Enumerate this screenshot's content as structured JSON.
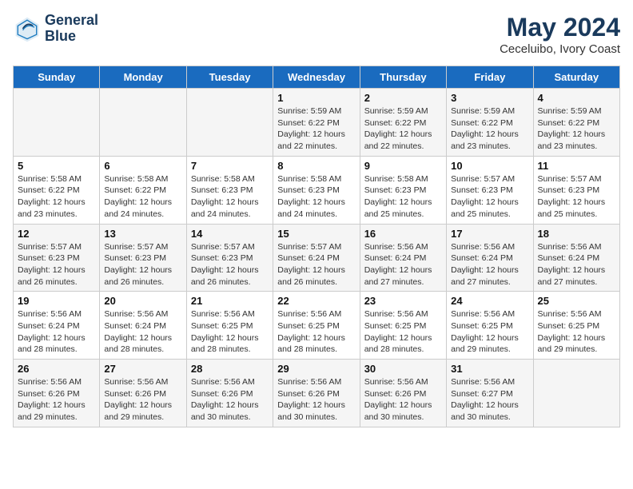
{
  "header": {
    "logo_line1": "General",
    "logo_line2": "Blue",
    "month_year": "May 2024",
    "location": "Ceceluibo, Ivory Coast"
  },
  "weekdays": [
    "Sunday",
    "Monday",
    "Tuesday",
    "Wednesday",
    "Thursday",
    "Friday",
    "Saturday"
  ],
  "weeks": [
    [
      {
        "day": "",
        "info": ""
      },
      {
        "day": "",
        "info": ""
      },
      {
        "day": "",
        "info": ""
      },
      {
        "day": "1",
        "info": "Sunrise: 5:59 AM\nSunset: 6:22 PM\nDaylight: 12 hours\nand 22 minutes."
      },
      {
        "day": "2",
        "info": "Sunrise: 5:59 AM\nSunset: 6:22 PM\nDaylight: 12 hours\nand 22 minutes."
      },
      {
        "day": "3",
        "info": "Sunrise: 5:59 AM\nSunset: 6:22 PM\nDaylight: 12 hours\nand 23 minutes."
      },
      {
        "day": "4",
        "info": "Sunrise: 5:59 AM\nSunset: 6:22 PM\nDaylight: 12 hours\nand 23 minutes."
      }
    ],
    [
      {
        "day": "5",
        "info": "Sunrise: 5:58 AM\nSunset: 6:22 PM\nDaylight: 12 hours\nand 23 minutes."
      },
      {
        "day": "6",
        "info": "Sunrise: 5:58 AM\nSunset: 6:22 PM\nDaylight: 12 hours\nand 24 minutes."
      },
      {
        "day": "7",
        "info": "Sunrise: 5:58 AM\nSunset: 6:23 PM\nDaylight: 12 hours\nand 24 minutes."
      },
      {
        "day": "8",
        "info": "Sunrise: 5:58 AM\nSunset: 6:23 PM\nDaylight: 12 hours\nand 24 minutes."
      },
      {
        "day": "9",
        "info": "Sunrise: 5:58 AM\nSunset: 6:23 PM\nDaylight: 12 hours\nand 25 minutes."
      },
      {
        "day": "10",
        "info": "Sunrise: 5:57 AM\nSunset: 6:23 PM\nDaylight: 12 hours\nand 25 minutes."
      },
      {
        "day": "11",
        "info": "Sunrise: 5:57 AM\nSunset: 6:23 PM\nDaylight: 12 hours\nand 25 minutes."
      }
    ],
    [
      {
        "day": "12",
        "info": "Sunrise: 5:57 AM\nSunset: 6:23 PM\nDaylight: 12 hours\nand 26 minutes."
      },
      {
        "day": "13",
        "info": "Sunrise: 5:57 AM\nSunset: 6:23 PM\nDaylight: 12 hours\nand 26 minutes."
      },
      {
        "day": "14",
        "info": "Sunrise: 5:57 AM\nSunset: 6:23 PM\nDaylight: 12 hours\nand 26 minutes."
      },
      {
        "day": "15",
        "info": "Sunrise: 5:57 AM\nSunset: 6:24 PM\nDaylight: 12 hours\nand 26 minutes."
      },
      {
        "day": "16",
        "info": "Sunrise: 5:56 AM\nSunset: 6:24 PM\nDaylight: 12 hours\nand 27 minutes."
      },
      {
        "day": "17",
        "info": "Sunrise: 5:56 AM\nSunset: 6:24 PM\nDaylight: 12 hours\nand 27 minutes."
      },
      {
        "day": "18",
        "info": "Sunrise: 5:56 AM\nSunset: 6:24 PM\nDaylight: 12 hours\nand 27 minutes."
      }
    ],
    [
      {
        "day": "19",
        "info": "Sunrise: 5:56 AM\nSunset: 6:24 PM\nDaylight: 12 hours\nand 28 minutes."
      },
      {
        "day": "20",
        "info": "Sunrise: 5:56 AM\nSunset: 6:24 PM\nDaylight: 12 hours\nand 28 minutes."
      },
      {
        "day": "21",
        "info": "Sunrise: 5:56 AM\nSunset: 6:25 PM\nDaylight: 12 hours\nand 28 minutes."
      },
      {
        "day": "22",
        "info": "Sunrise: 5:56 AM\nSunset: 6:25 PM\nDaylight: 12 hours\nand 28 minutes."
      },
      {
        "day": "23",
        "info": "Sunrise: 5:56 AM\nSunset: 6:25 PM\nDaylight: 12 hours\nand 28 minutes."
      },
      {
        "day": "24",
        "info": "Sunrise: 5:56 AM\nSunset: 6:25 PM\nDaylight: 12 hours\nand 29 minutes."
      },
      {
        "day": "25",
        "info": "Sunrise: 5:56 AM\nSunset: 6:25 PM\nDaylight: 12 hours\nand 29 minutes."
      }
    ],
    [
      {
        "day": "26",
        "info": "Sunrise: 5:56 AM\nSunset: 6:26 PM\nDaylight: 12 hours\nand 29 minutes."
      },
      {
        "day": "27",
        "info": "Sunrise: 5:56 AM\nSunset: 6:26 PM\nDaylight: 12 hours\nand 29 minutes."
      },
      {
        "day": "28",
        "info": "Sunrise: 5:56 AM\nSunset: 6:26 PM\nDaylight: 12 hours\nand 30 minutes."
      },
      {
        "day": "29",
        "info": "Sunrise: 5:56 AM\nSunset: 6:26 PM\nDaylight: 12 hours\nand 30 minutes."
      },
      {
        "day": "30",
        "info": "Sunrise: 5:56 AM\nSunset: 6:26 PM\nDaylight: 12 hours\nand 30 minutes."
      },
      {
        "day": "31",
        "info": "Sunrise: 5:56 AM\nSunset: 6:27 PM\nDaylight: 12 hours\nand 30 minutes."
      },
      {
        "day": "",
        "info": ""
      }
    ]
  ]
}
